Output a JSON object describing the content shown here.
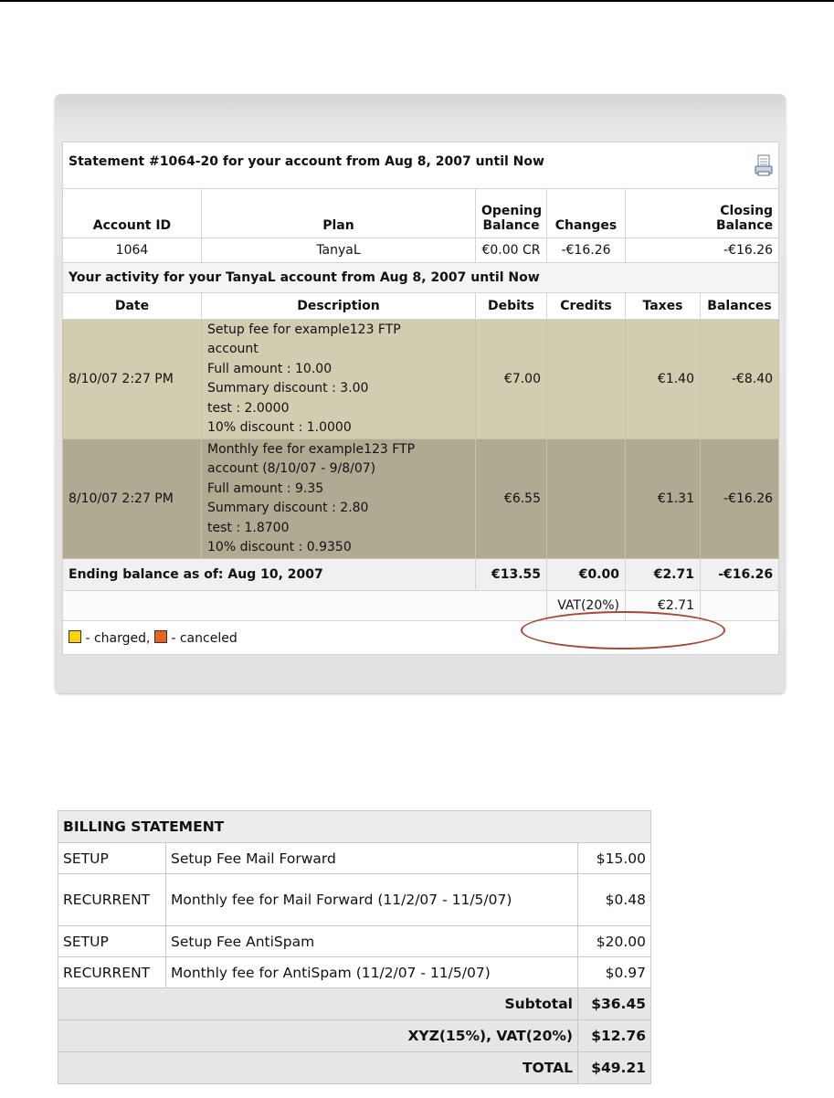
{
  "statement": {
    "title": "Statement #1064-20 for your account from Aug 8, 2007 until Now",
    "headers": {
      "account_id": "Account ID",
      "plan": "Plan",
      "opening_balance": [
        "Opening",
        "Balance"
      ],
      "changes": "Changes",
      "closing_balance": [
        "Closing",
        "Balance"
      ]
    },
    "account": {
      "id": "1064",
      "plan": "TanyaL",
      "opening_balance": "€0.00 CR",
      "changes": "-€16.26",
      "closing_balance": "-€16.26"
    },
    "activity_title": "Your activity for your TanyaL account from Aug 8, 2007 until Now",
    "activity_headers": {
      "date": "Date",
      "description": "Description",
      "debits": "Debits",
      "credits": "Credits",
      "taxes": "Taxes",
      "balances": "Balances"
    },
    "lines": [
      {
        "date": "8/10/07 2:27 PM",
        "description": [
          "Setup fee for example123 FTP",
          "account",
          "Full amount : 10.00",
          "Summary discount : 3.00",
          "test : 2.0000",
          "10% discount : 1.0000"
        ],
        "debit": "€7.00",
        "credit": "",
        "tax": "€1.40",
        "balance": "-€8.40"
      },
      {
        "date": "8/10/07 2:27 PM",
        "description": [
          "Monthly fee for example123 FTP",
          "account (8/10/07 - 9/8/07)",
          "Full amount : 9.35",
          "Summary discount : 2.80",
          "test : 1.8700",
          "10% discount : 0.9350"
        ],
        "debit": "€6.55",
        "credit": "",
        "tax": "€1.31",
        "balance": "-€16.26"
      }
    ],
    "ending": {
      "label": "Ending balance as of: Aug 10, 2007",
      "debits": "€13.55",
      "credits": "€0.00",
      "taxes": "€2.71",
      "balance": "-€16.26"
    },
    "vat": {
      "label": "VAT(20%)",
      "value": "€2.71"
    },
    "legend": {
      "charged": "- charged,",
      "canceled": "- canceled"
    },
    "colors": {
      "charged": "#f5d400",
      "canceled": "#e8641e",
      "highlight_ellipse": "#a0483a"
    }
  },
  "billing": {
    "title": "BILLING STATEMENT",
    "items": [
      {
        "type": "SETUP",
        "description": "Setup Fee Mail Forward",
        "amount": "$15.00"
      },
      {
        "type": "RECURRENT",
        "description": "Monthly fee for Mail Forward (11/2/07 - 11/5/07)",
        "amount": "$0.48"
      },
      {
        "type": "SETUP",
        "description": "Setup Fee AntiSpam",
        "amount": "$20.00"
      },
      {
        "type": "RECURRENT",
        "description": "Monthly fee for AntiSpam (11/2/07 - 11/5/07)",
        "amount": "$0.97"
      }
    ],
    "subtotal": {
      "label": "Subtotal",
      "amount": "$36.45"
    },
    "tax": {
      "label": "XYZ(15%), VAT(20%)",
      "amount": "$12.76"
    },
    "total": {
      "label": "TOTAL",
      "amount": "$49.21"
    }
  }
}
